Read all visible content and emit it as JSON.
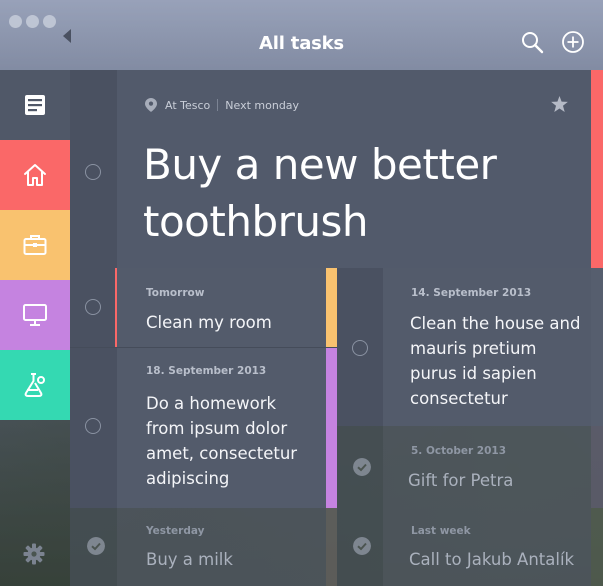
{
  "window": {
    "title": "All tasks",
    "icons": [
      "search-icon",
      "add-icon"
    ]
  },
  "sidebar": {
    "items": [
      {
        "name": "inbox",
        "icon": "inbox-icon",
        "color": "#505868"
      },
      {
        "name": "home",
        "icon": "home-icon",
        "color": "#fa6868"
      },
      {
        "name": "work",
        "icon": "briefcase-icon",
        "color": "#f9c26f"
      },
      {
        "name": "screen",
        "icon": "monitor-icon",
        "color": "#c583e0"
      },
      {
        "name": "science",
        "icon": "flask-icon",
        "color": "#34d9b2"
      }
    ],
    "settings_icon": "gear-icon"
  },
  "featured_task": {
    "location": "At Tesco",
    "due": "Next monday",
    "title": "Buy a new better toothbrush",
    "starred": true,
    "accent": "#fa6868"
  },
  "tasks_left": [
    {
      "date": "Tomorrow",
      "title": "Clean my room",
      "accent": "#f9c26f",
      "done": false
    },
    {
      "date": "18. September 2013",
      "title": "Do a homework from ipsum dolor amet, consectetur adipiscing",
      "accent": "#c583e0",
      "done": false
    },
    {
      "date": "Yesterday",
      "title": "Buy a milk",
      "done": true
    }
  ],
  "tasks_right": [
    {
      "date": "14. September 2013",
      "title": "Clean the house and mauris pretium purus id sapien consectetur",
      "done": false
    },
    {
      "date": "5. October 2013",
      "title": "Gift for Petra",
      "done": true
    },
    {
      "date": "Last week",
      "title": "Call to Jakub Antalík",
      "done": true
    }
  ]
}
